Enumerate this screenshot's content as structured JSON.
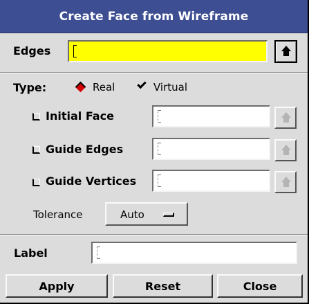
{
  "window": {
    "title": "Create Face from Wireframe"
  },
  "edges": {
    "label": "Edges",
    "value": ""
  },
  "type": {
    "label": "Type:",
    "options": [
      {
        "label": "Real",
        "selected": true
      },
      {
        "label": "Virtual",
        "selected": false
      }
    ]
  },
  "options": {
    "initial_face": {
      "label": "Initial Face",
      "checked": false,
      "value": ""
    },
    "guide_edges": {
      "label": "Guide Edges",
      "checked": false,
      "value": ""
    },
    "guide_vertices": {
      "label": "Guide Vertices",
      "checked": false,
      "value": ""
    }
  },
  "tolerance": {
    "label": "Tolerance",
    "value": "Auto"
  },
  "name_label": {
    "label": "Label",
    "value": ""
  },
  "buttons": {
    "apply": "Apply",
    "reset": "Reset",
    "close": "Close"
  },
  "colors": {
    "title_bg": "#3d4e92",
    "active_field": "#ffff00",
    "selected_radio": "#d40000",
    "window_bg": "#dcdcdc"
  }
}
